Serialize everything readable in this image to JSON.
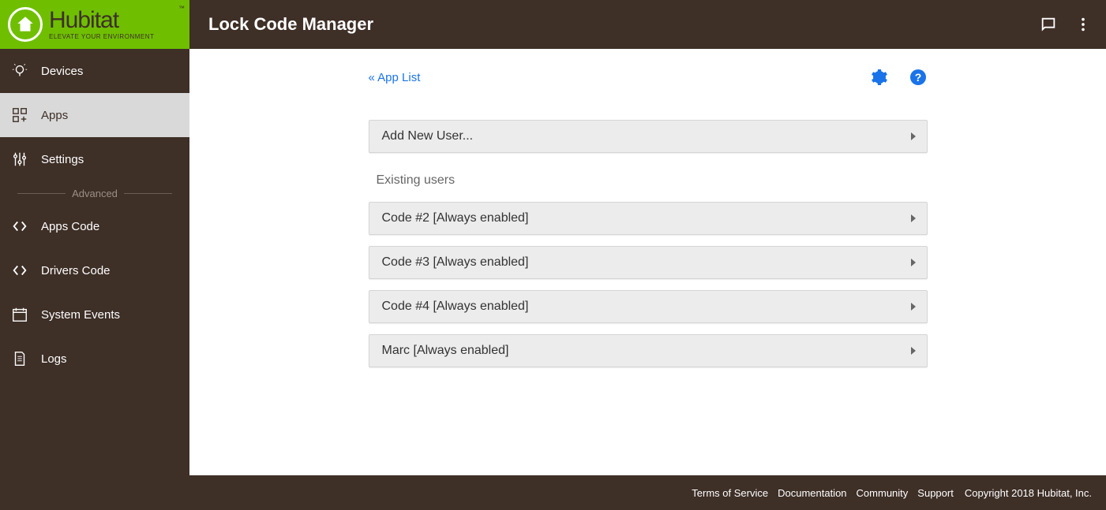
{
  "brand": {
    "name": "Hubitat",
    "tagline": "ELEVATE YOUR ENVIRONMENT",
    "tm": "™"
  },
  "header": {
    "title": "Lock Code Manager"
  },
  "sidebar": {
    "items": [
      {
        "label": "Devices"
      },
      {
        "label": "Apps"
      },
      {
        "label": "Settings"
      }
    ],
    "advanced_label": "Advanced",
    "advanced_items": [
      {
        "label": "Apps Code"
      },
      {
        "label": "Drivers Code"
      },
      {
        "label": "System Events"
      },
      {
        "label": "Logs"
      }
    ]
  },
  "main": {
    "breadcrumb": "« App List",
    "add_user_label": "Add New User...",
    "existing_label": "Existing users",
    "users": [
      {
        "label": "Code #2 [Always enabled]"
      },
      {
        "label": "Code #3 [Always enabled]"
      },
      {
        "label": "Code #4 [Always enabled]"
      },
      {
        "label": "Marc [Always enabled]"
      }
    ]
  },
  "footer": {
    "links": [
      "Terms of Service",
      "Documentation",
      "Community",
      "Support"
    ],
    "copyright": "Copyright 2018 Hubitat, Inc."
  }
}
